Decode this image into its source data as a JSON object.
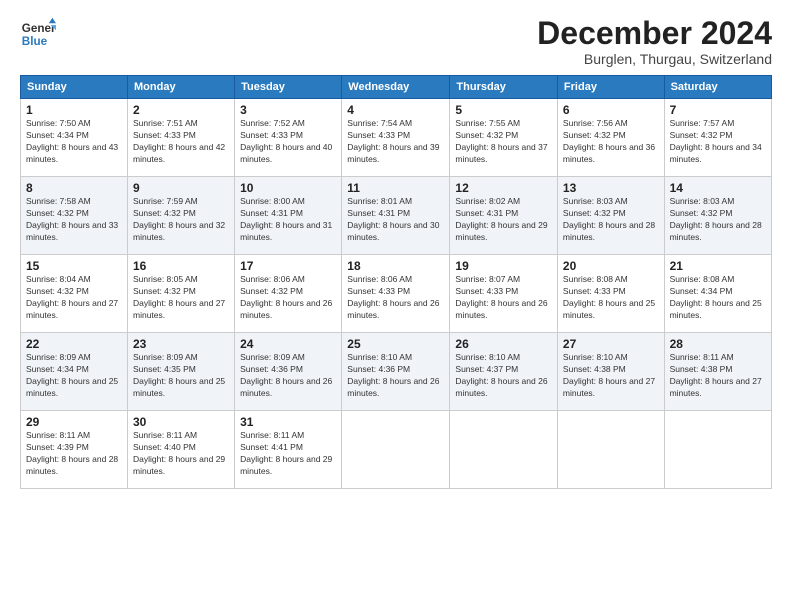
{
  "header": {
    "logo_line1": "General",
    "logo_line2": "Blue",
    "title": "December 2024",
    "subtitle": "Burglen, Thurgau, Switzerland"
  },
  "weekdays": [
    "Sunday",
    "Monday",
    "Tuesday",
    "Wednesday",
    "Thursday",
    "Friday",
    "Saturday"
  ],
  "weeks": [
    [
      {
        "day": "1",
        "sunrise": "Sunrise: 7:50 AM",
        "sunset": "Sunset: 4:34 PM",
        "daylight": "Daylight: 8 hours and 43 minutes."
      },
      {
        "day": "2",
        "sunrise": "Sunrise: 7:51 AM",
        "sunset": "Sunset: 4:33 PM",
        "daylight": "Daylight: 8 hours and 42 minutes."
      },
      {
        "day": "3",
        "sunrise": "Sunrise: 7:52 AM",
        "sunset": "Sunset: 4:33 PM",
        "daylight": "Daylight: 8 hours and 40 minutes."
      },
      {
        "day": "4",
        "sunrise": "Sunrise: 7:54 AM",
        "sunset": "Sunset: 4:33 PM",
        "daylight": "Daylight: 8 hours and 39 minutes."
      },
      {
        "day": "5",
        "sunrise": "Sunrise: 7:55 AM",
        "sunset": "Sunset: 4:32 PM",
        "daylight": "Daylight: 8 hours and 37 minutes."
      },
      {
        "day": "6",
        "sunrise": "Sunrise: 7:56 AM",
        "sunset": "Sunset: 4:32 PM",
        "daylight": "Daylight: 8 hours and 36 minutes."
      },
      {
        "day": "7",
        "sunrise": "Sunrise: 7:57 AM",
        "sunset": "Sunset: 4:32 PM",
        "daylight": "Daylight: 8 hours and 34 minutes."
      }
    ],
    [
      {
        "day": "8",
        "sunrise": "Sunrise: 7:58 AM",
        "sunset": "Sunset: 4:32 PM",
        "daylight": "Daylight: 8 hours and 33 minutes."
      },
      {
        "day": "9",
        "sunrise": "Sunrise: 7:59 AM",
        "sunset": "Sunset: 4:32 PM",
        "daylight": "Daylight: 8 hours and 32 minutes."
      },
      {
        "day": "10",
        "sunrise": "Sunrise: 8:00 AM",
        "sunset": "Sunset: 4:31 PM",
        "daylight": "Daylight: 8 hours and 31 minutes."
      },
      {
        "day": "11",
        "sunrise": "Sunrise: 8:01 AM",
        "sunset": "Sunset: 4:31 PM",
        "daylight": "Daylight: 8 hours and 30 minutes."
      },
      {
        "day": "12",
        "sunrise": "Sunrise: 8:02 AM",
        "sunset": "Sunset: 4:31 PM",
        "daylight": "Daylight: 8 hours and 29 minutes."
      },
      {
        "day": "13",
        "sunrise": "Sunrise: 8:03 AM",
        "sunset": "Sunset: 4:32 PM",
        "daylight": "Daylight: 8 hours and 28 minutes."
      },
      {
        "day": "14",
        "sunrise": "Sunrise: 8:03 AM",
        "sunset": "Sunset: 4:32 PM",
        "daylight": "Daylight: 8 hours and 28 minutes."
      }
    ],
    [
      {
        "day": "15",
        "sunrise": "Sunrise: 8:04 AM",
        "sunset": "Sunset: 4:32 PM",
        "daylight": "Daylight: 8 hours and 27 minutes."
      },
      {
        "day": "16",
        "sunrise": "Sunrise: 8:05 AM",
        "sunset": "Sunset: 4:32 PM",
        "daylight": "Daylight: 8 hours and 27 minutes."
      },
      {
        "day": "17",
        "sunrise": "Sunrise: 8:06 AM",
        "sunset": "Sunset: 4:32 PM",
        "daylight": "Daylight: 8 hours and 26 minutes."
      },
      {
        "day": "18",
        "sunrise": "Sunrise: 8:06 AM",
        "sunset": "Sunset: 4:33 PM",
        "daylight": "Daylight: 8 hours and 26 minutes."
      },
      {
        "day": "19",
        "sunrise": "Sunrise: 8:07 AM",
        "sunset": "Sunset: 4:33 PM",
        "daylight": "Daylight: 8 hours and 26 minutes."
      },
      {
        "day": "20",
        "sunrise": "Sunrise: 8:08 AM",
        "sunset": "Sunset: 4:33 PM",
        "daylight": "Daylight: 8 hours and 25 minutes."
      },
      {
        "day": "21",
        "sunrise": "Sunrise: 8:08 AM",
        "sunset": "Sunset: 4:34 PM",
        "daylight": "Daylight: 8 hours and 25 minutes."
      }
    ],
    [
      {
        "day": "22",
        "sunrise": "Sunrise: 8:09 AM",
        "sunset": "Sunset: 4:34 PM",
        "daylight": "Daylight: 8 hours and 25 minutes."
      },
      {
        "day": "23",
        "sunrise": "Sunrise: 8:09 AM",
        "sunset": "Sunset: 4:35 PM",
        "daylight": "Daylight: 8 hours and 25 minutes."
      },
      {
        "day": "24",
        "sunrise": "Sunrise: 8:09 AM",
        "sunset": "Sunset: 4:36 PM",
        "daylight": "Daylight: 8 hours and 26 minutes."
      },
      {
        "day": "25",
        "sunrise": "Sunrise: 8:10 AM",
        "sunset": "Sunset: 4:36 PM",
        "daylight": "Daylight: 8 hours and 26 minutes."
      },
      {
        "day": "26",
        "sunrise": "Sunrise: 8:10 AM",
        "sunset": "Sunset: 4:37 PM",
        "daylight": "Daylight: 8 hours and 26 minutes."
      },
      {
        "day": "27",
        "sunrise": "Sunrise: 8:10 AM",
        "sunset": "Sunset: 4:38 PM",
        "daylight": "Daylight: 8 hours and 27 minutes."
      },
      {
        "day": "28",
        "sunrise": "Sunrise: 8:11 AM",
        "sunset": "Sunset: 4:38 PM",
        "daylight": "Daylight: 8 hours and 27 minutes."
      }
    ],
    [
      {
        "day": "29",
        "sunrise": "Sunrise: 8:11 AM",
        "sunset": "Sunset: 4:39 PM",
        "daylight": "Daylight: 8 hours and 28 minutes."
      },
      {
        "day": "30",
        "sunrise": "Sunrise: 8:11 AM",
        "sunset": "Sunset: 4:40 PM",
        "daylight": "Daylight: 8 hours and 29 minutes."
      },
      {
        "day": "31",
        "sunrise": "Sunrise: 8:11 AM",
        "sunset": "Sunset: 4:41 PM",
        "daylight": "Daylight: 8 hours and 29 minutes."
      },
      null,
      null,
      null,
      null
    ]
  ]
}
